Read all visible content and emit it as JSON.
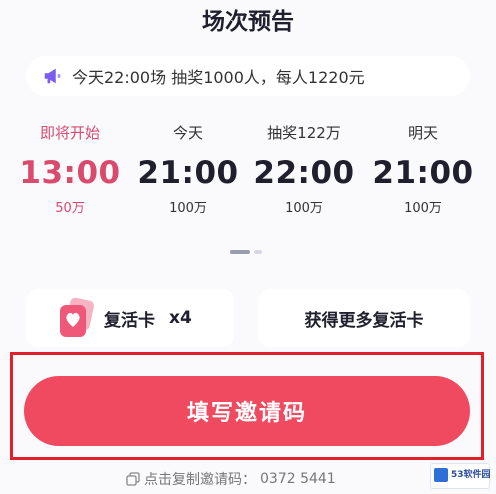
{
  "header": {
    "title": "场次预告"
  },
  "announcement": {
    "icon": "megaphone-icon",
    "text": "今天22:00场 抽奖1000人，每人1220元"
  },
  "schedule": [
    {
      "label": "即将开始",
      "time": "13:00",
      "amount": "50万",
      "active": true
    },
    {
      "label": "今天",
      "time": "21:00",
      "amount": "100万",
      "active": false
    },
    {
      "label": "抽奖122万",
      "time": "22:00",
      "amount": "100万",
      "active": false
    },
    {
      "label": "明天",
      "time": "21:00",
      "amount": "100万",
      "active": false
    }
  ],
  "revive": {
    "label": "复活卡",
    "count": "x4",
    "icon": "heart-card-icon"
  },
  "more_revive": {
    "label": "获得更多复活卡"
  },
  "invite_button": {
    "label": "填写邀请码"
  },
  "copy_hint": {
    "label": "点击复制邀请码：",
    "code": "0372 5441",
    "icon": "copy-icon"
  },
  "watermark": {
    "text": "53软件园"
  },
  "colors": {
    "accent": "#ef4a60",
    "active_text": "#d94a6d",
    "highlight_frame": "#e0202a",
    "announce_icon": "#7b5cf0"
  }
}
